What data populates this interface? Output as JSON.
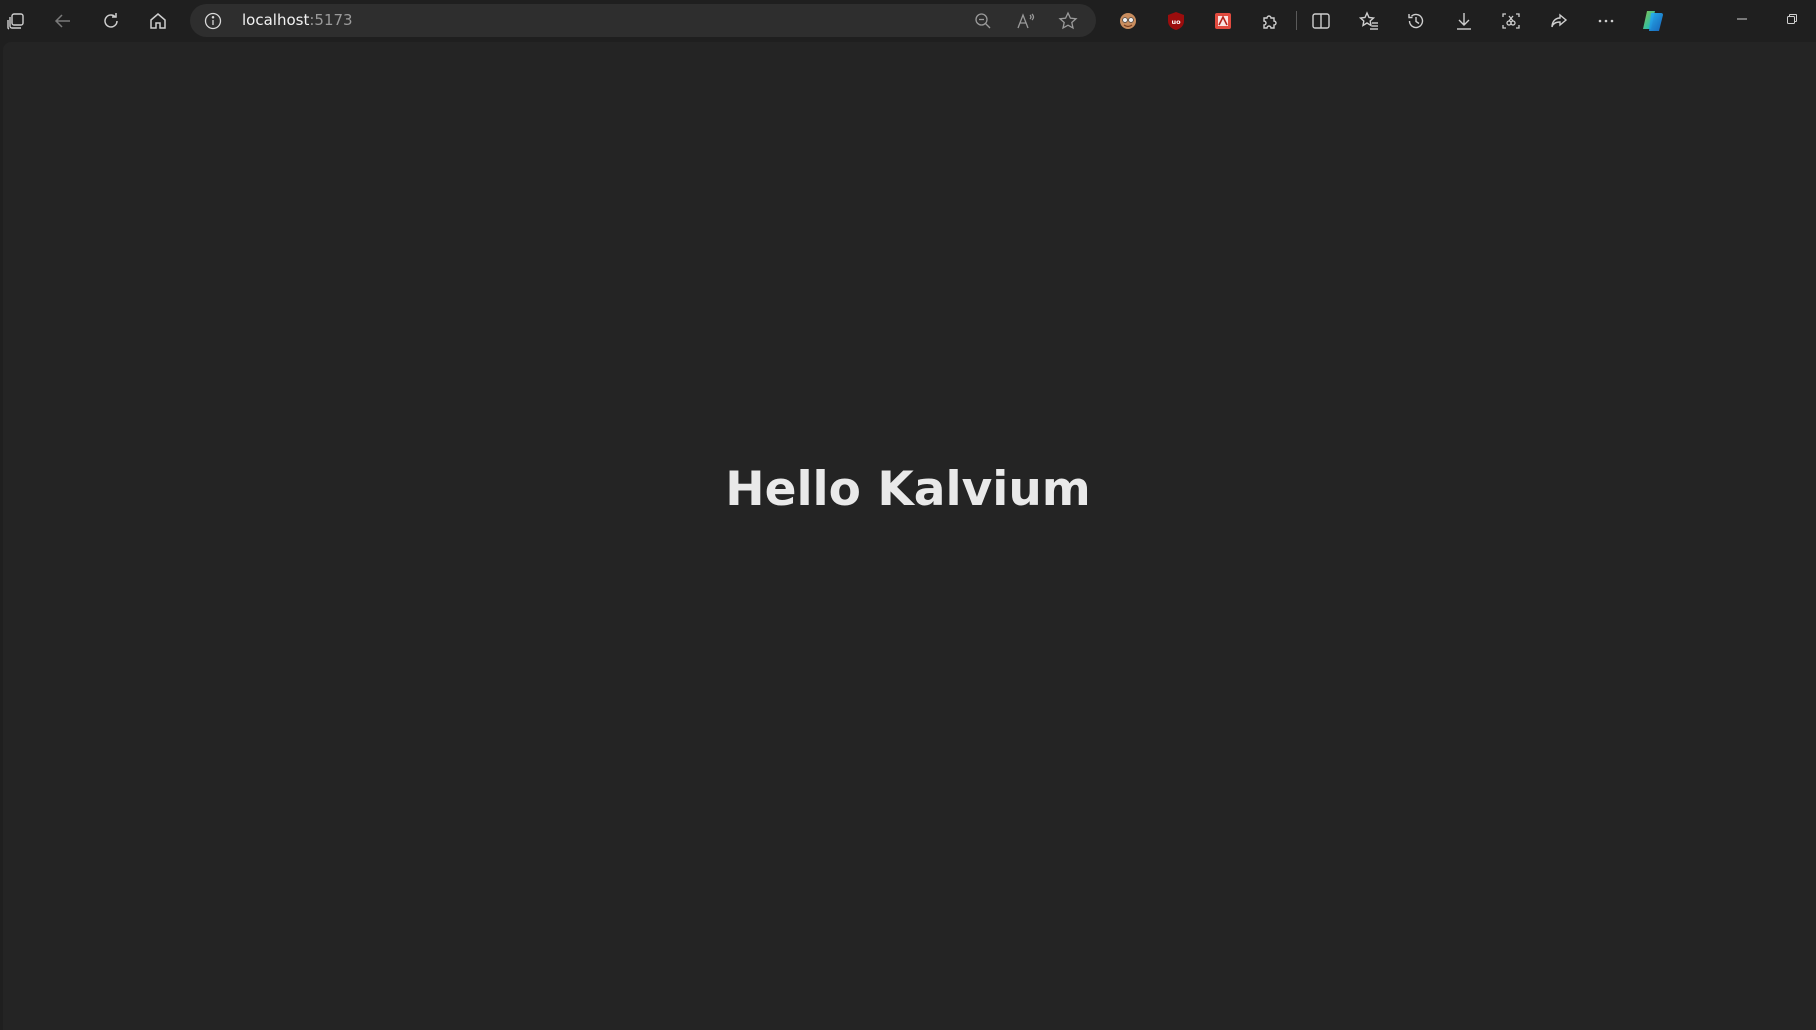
{
  "browser": {
    "address_bar": {
      "host": "localhost",
      "port": ":5173"
    },
    "toolbar_icons": [
      "workspaces-icon",
      "back-icon",
      "refresh-icon",
      "home-icon",
      "zoom-out-icon",
      "read-aloud-icon",
      "favorite-star-icon",
      "extension-avatar-icon",
      "ublock-icon",
      "extension-red-icon",
      "extensions-puzzle-icon",
      "split-screen-icon",
      "favorites-icon",
      "history-icon",
      "downloads-icon",
      "screenshot-icon",
      "share-icon",
      "more-icon",
      "copilot-icon",
      "minimize-icon",
      "restore-icon"
    ],
    "colors": {
      "toolbar_bg": "#1f1f1f",
      "address_bg": "#2e2e2e",
      "page_bg": "#242424",
      "heading_text": "#e9e9e9"
    }
  },
  "page": {
    "heading": "Hello Kalvium"
  }
}
